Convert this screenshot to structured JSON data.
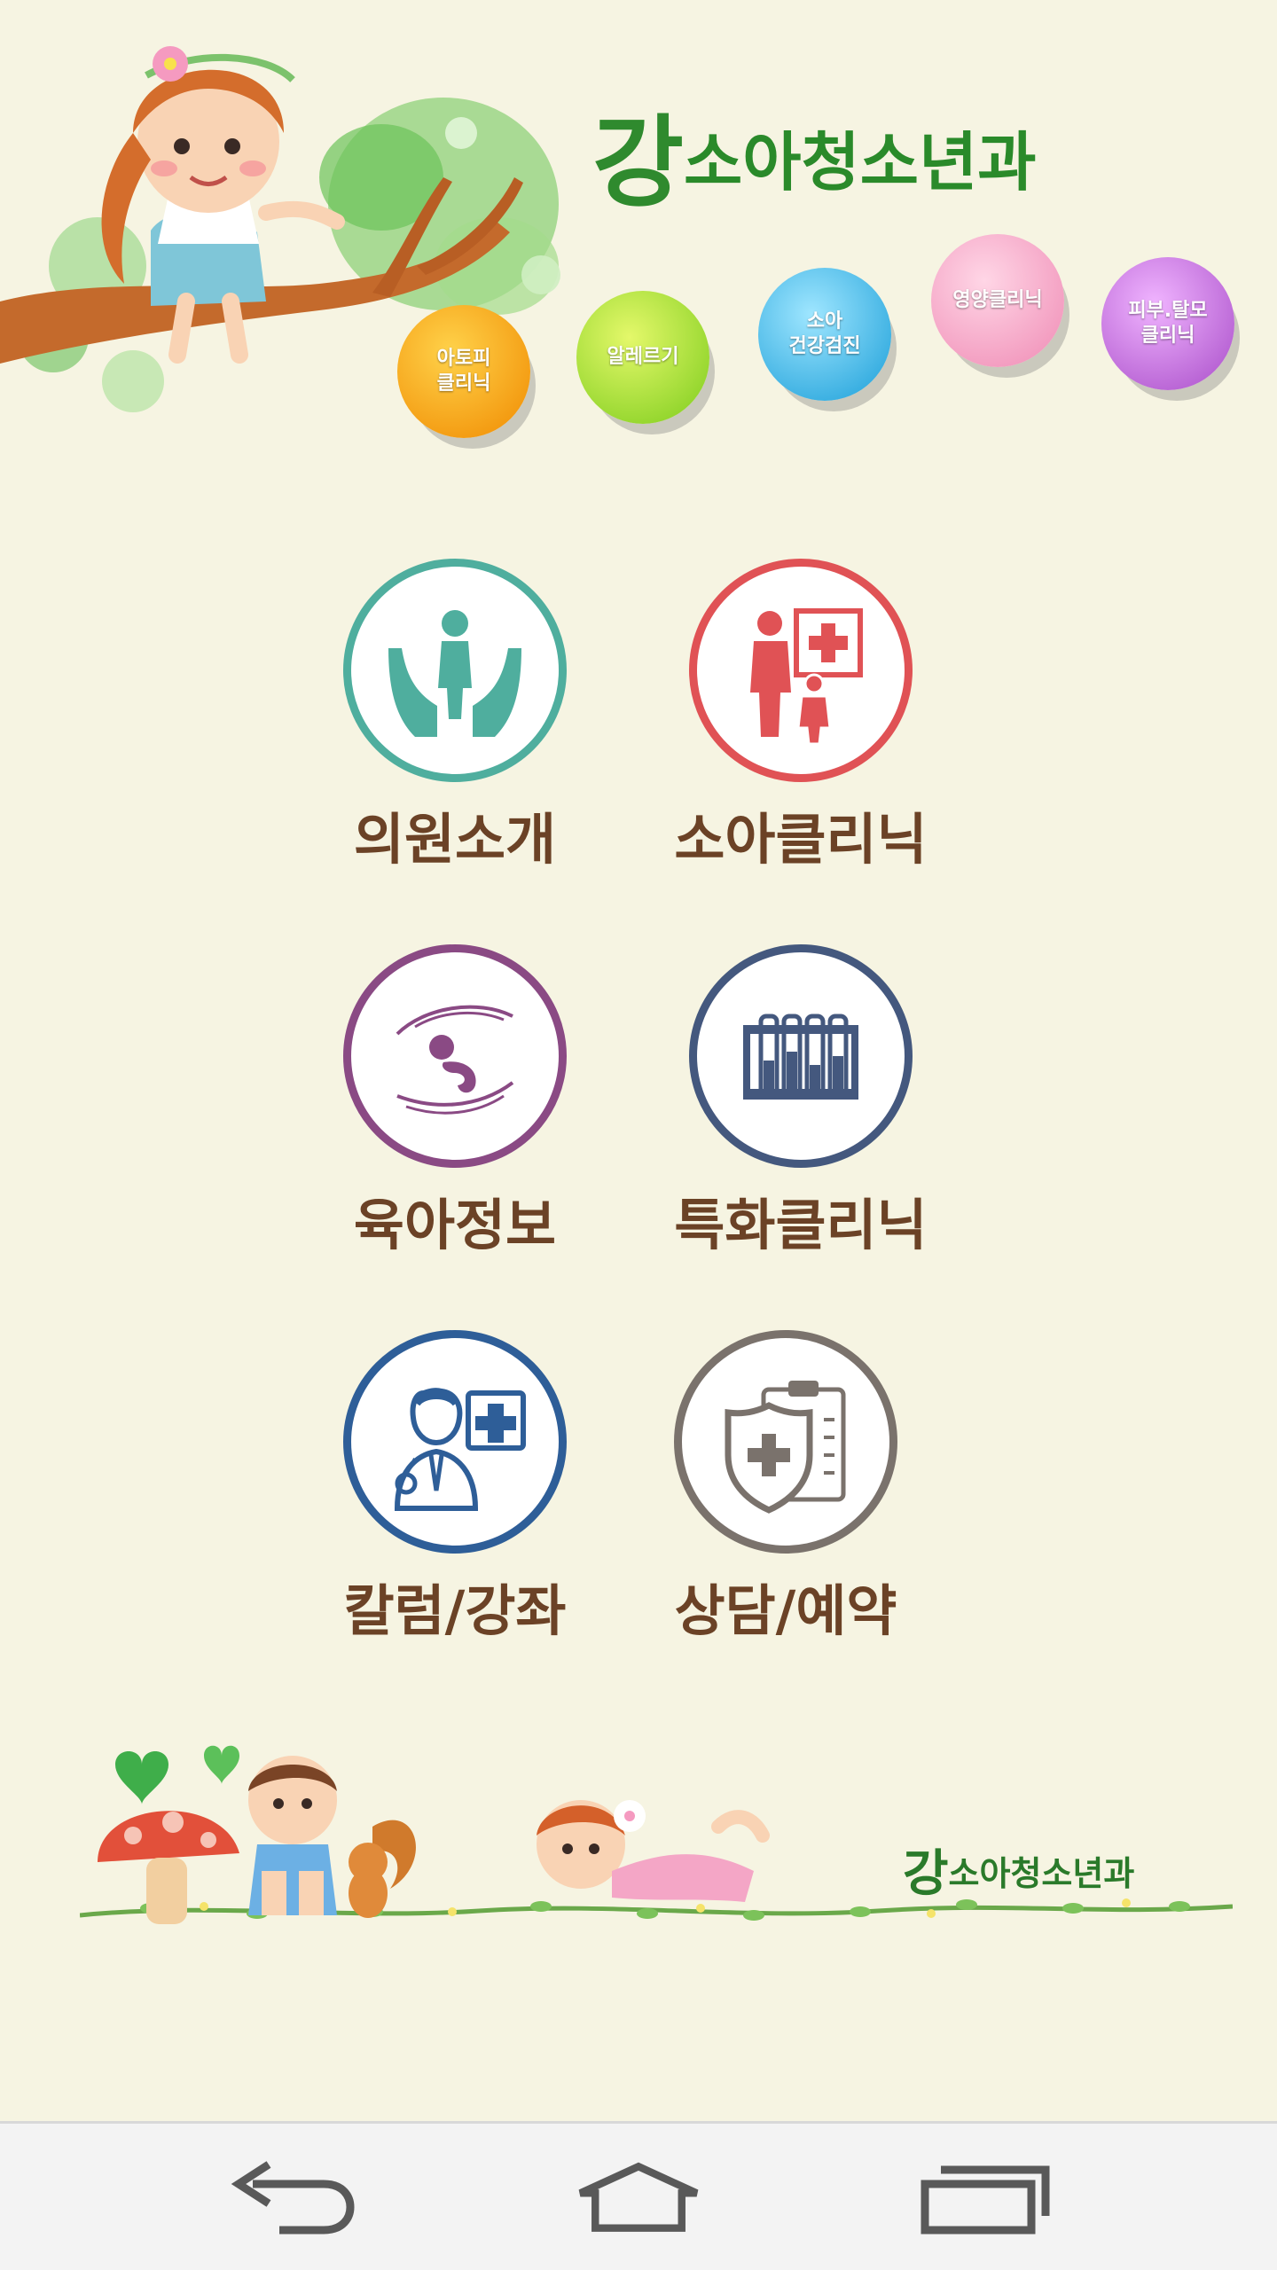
{
  "header": {
    "brand_first": "강",
    "brand_rest": "소아청소년과",
    "sub_clinics": [
      {
        "label": "아토피\n클리닉",
        "color": "#f5a800"
      },
      {
        "label": "알레르기",
        "color": "#9ed42a"
      },
      {
        "label": "소아\n건강검진",
        "color": "#2ab4e8"
      },
      {
        "label": "영양클리닉",
        "color": "#f4a2c4"
      },
      {
        "label": "피부.탈모\n클리닉",
        "color": "#c06ad8"
      }
    ]
  },
  "menu": [
    {
      "label": "의원소개",
      "icon": "hands-person-icon",
      "color": "#4fae9e"
    },
    {
      "label": "소아클리닉",
      "icon": "parent-child-medical-icon",
      "color": "#e05255"
    },
    {
      "label": "육아정보",
      "icon": "baby-in-hands-icon",
      "color": "#8a4a84"
    },
    {
      "label": "특화클리닉",
      "icon": "test-tubes-icon",
      "color": "#44587e"
    },
    {
      "label": "칼럼/강좌",
      "icon": "doctor-icon",
      "color": "#2e5e98"
    },
    {
      "label": "상담/예약",
      "icon": "shield-clipboard-icon",
      "color": "#7a726c"
    }
  ],
  "footer": {
    "brand_first": "강",
    "brand_rest": "소아청소년과"
  },
  "navbar": {
    "icons": [
      "back-icon",
      "home-icon",
      "recent-apps-icon"
    ]
  }
}
